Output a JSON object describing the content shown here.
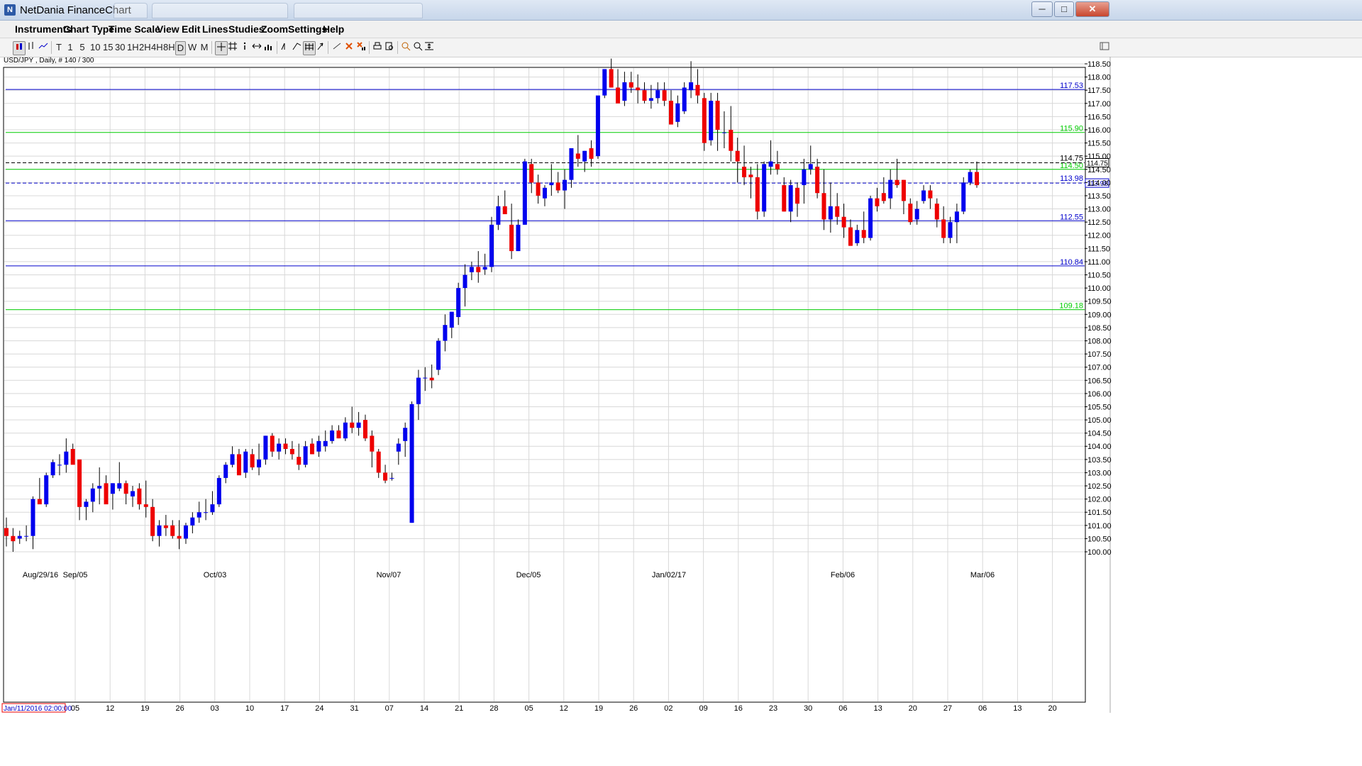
{
  "window": {
    "title": "NetDania FinanceChart",
    "controls": [
      "─",
      "□",
      "✕"
    ]
  },
  "menu": [
    "Instruments",
    "Chart Type",
    "Time Scale",
    "View",
    "Edit",
    "Lines",
    "Studies",
    "Zoom",
    "Settings",
    "Help"
  ],
  "toolbar": {
    "periods": [
      "T",
      "1",
      "5",
      "10",
      "15",
      "30",
      "1H",
      "2H",
      "4H",
      "8H",
      "D",
      "W",
      "M"
    ],
    "selected_period": "D"
  },
  "chart_info": "USD/JPY , Daily, # 140 / 300",
  "start_date_label": "Jan/11/2016 02:00:00",
  "chart_data": {
    "type": "candlestick",
    "instrument": "USD/JPY",
    "interval": "Daily",
    "ylim": [
      99.75,
      119.0
    ],
    "y_ticks": [
      100.0,
      100.5,
      101.0,
      101.5,
      102.0,
      102.5,
      103.0,
      103.5,
      104.0,
      104.5,
      105.0,
      105.5,
      106.0,
      106.5,
      107.0,
      107.5,
      108.0,
      108.5,
      109.0,
      109.5,
      110.0,
      110.5,
      111.0,
      111.5,
      112.0,
      112.5,
      113.0,
      113.5,
      114.0,
      114.5,
      115.0,
      115.5,
      116.0,
      116.5,
      117.0,
      117.5,
      118.0,
      118.5
    ],
    "x_ticks": [
      "05",
      "12",
      "19",
      "26",
      "03",
      "10",
      "17",
      "24",
      "31",
      "07",
      "14",
      "21",
      "28",
      "05",
      "12",
      "19",
      "26",
      "02",
      "09",
      "16",
      "23",
      "30",
      "06",
      "13",
      "20",
      "27",
      "06",
      "13",
      "20"
    ],
    "x_month_labels": [
      {
        "label": "Aug/29/16",
        "at": "Aug/29"
      },
      {
        "label": "Sep/05",
        "at": "05"
      },
      {
        "label": "Oct/03",
        "at": "03"
      },
      {
        "label": "Nov/07",
        "at": "07"
      },
      {
        "label": "Dec/05",
        "at": "05"
      },
      {
        "label": "Jan/02/17",
        "at": "02"
      },
      {
        "label": "Feb/06",
        "at": "06"
      },
      {
        "label": "Mar/06",
        "at": "06"
      }
    ],
    "horizontal_lines": [
      {
        "value": 117.53,
        "label": "117.53",
        "color": "#0000cc",
        "style": "solid"
      },
      {
        "value": 115.9,
        "label": "115.90",
        "color": "#00cc00",
        "style": "solid"
      },
      {
        "value": 114.5,
        "label": "114.50",
        "color": "#00cc00",
        "style": "solid"
      },
      {
        "value": 112.55,
        "label": "112.55",
        "color": "#0000cc",
        "style": "solid"
      },
      {
        "value": 110.84,
        "label": "110.84",
        "color": "#0000cc",
        "style": "solid"
      },
      {
        "value": 109.18,
        "label": "109.18",
        "color": "#00cc00",
        "style": "solid"
      },
      {
        "value": 114.75,
        "label": "114.75",
        "color": "#000000",
        "style": "dashed",
        "tag": "114.75"
      },
      {
        "value": 113.98,
        "label": "113.98",
        "color": "#0000cc",
        "style": "dashed",
        "tag": "113.98"
      }
    ],
    "colors": {
      "up": "#0000ee",
      "down": "#ee0000",
      "grid": "#d8d8d8"
    },
    "grid": true,
    "candles": [
      [
        100.9,
        101.3,
        100.2,
        100.6
      ],
      [
        100.6,
        100.9,
        100.0,
        100.4
      ],
      [
        100.5,
        100.8,
        100.3,
        100.6
      ],
      [
        100.6,
        101.0,
        100.4,
        100.6
      ],
      [
        100.6,
        102.1,
        100.1,
        102.0
      ],
      [
        102.0,
        102.8,
        101.9,
        101.8
      ],
      [
        101.8,
        103.0,
        101.7,
        102.9
      ],
      [
        102.9,
        103.5,
        102.8,
        103.4
      ],
      [
        103.3,
        103.7,
        102.9,
        103.3
      ],
      [
        103.3,
        104.3,
        103.0,
        103.8
      ],
      [
        103.9,
        104.1,
        103.6,
        103.3
      ],
      [
        103.5,
        103.5,
        101.2,
        101.7
      ],
      [
        101.7,
        102.0,
        101.2,
        101.9
      ],
      [
        101.9,
        102.6,
        101.5,
        102.4
      ],
      [
        102.4,
        103.2,
        101.8,
        102.5
      ],
      [
        102.6,
        102.9,
        101.9,
        101.8
      ],
      [
        102.2,
        102.6,
        101.6,
        102.6
      ],
      [
        102.4,
        103.4,
        102.3,
        102.6
      ],
      [
        102.6,
        102.7,
        101.8,
        102.2
      ],
      [
        102.1,
        102.5,
        101.7,
        102.3
      ],
      [
        102.4,
        102.6,
        101.6,
        101.8
      ],
      [
        101.8,
        102.7,
        101.3,
        101.7
      ],
      [
        101.7,
        102.0,
        100.4,
        100.6
      ],
      [
        100.6,
        101.2,
        100.2,
        101.0
      ],
      [
        101.0,
        101.4,
        100.6,
        100.9
      ],
      [
        101.0,
        101.2,
        100.5,
        100.6
      ],
      [
        100.6,
        101.2,
        100.1,
        100.5
      ],
      [
        100.5,
        101.1,
        100.3,
        101.0
      ],
      [
        101.0,
        101.5,
        100.7,
        101.3
      ],
      [
        101.3,
        101.9,
        101.1,
        101.5
      ],
      [
        101.5,
        102.0,
        101.2,
        101.5
      ],
      [
        101.5,
        102.3,
        101.4,
        101.8
      ],
      [
        101.8,
        102.9,
        101.7,
        102.8
      ],
      [
        102.8,
        103.4,
        102.6,
        103.3
      ],
      [
        103.3,
        104.0,
        103.2,
        103.7
      ],
      [
        103.7,
        103.9,
        103.1,
        102.9
      ],
      [
        103.0,
        103.9,
        102.8,
        103.8
      ],
      [
        103.7,
        103.9,
        103.1,
        103.2
      ],
      [
        103.2,
        104.1,
        102.9,
        103.5
      ],
      [
        103.5,
        104.4,
        103.3,
        104.4
      ],
      [
        104.4,
        104.5,
        103.6,
        103.8
      ],
      [
        103.8,
        104.3,
        103.5,
        104.1
      ],
      [
        104.1,
        104.3,
        103.7,
        103.9
      ],
      [
        103.9,
        104.2,
        103.5,
        103.7
      ],
      [
        103.6,
        104.1,
        103.1,
        103.3
      ],
      [
        103.3,
        104.2,
        103.2,
        104.0
      ],
      [
        104.1,
        104.3,
        103.7,
        103.7
      ],
      [
        103.8,
        104.4,
        103.6,
        104.2
      ],
      [
        104.0,
        104.6,
        103.8,
        104.2
      ],
      [
        104.2,
        104.8,
        104.1,
        104.6
      ],
      [
        104.6,
        104.8,
        104.3,
        104.3
      ],
      [
        104.3,
        105.1,
        104.2,
        104.9
      ],
      [
        104.9,
        105.5,
        104.5,
        104.7
      ],
      [
        104.7,
        105.3,
        104.4,
        104.9
      ],
      [
        105.0,
        105.2,
        104.2,
        104.3
      ],
      [
        104.4,
        104.6,
        103.2,
        103.8
      ],
      [
        103.8,
        103.9,
        102.8,
        103.0
      ],
      [
        103.0,
        103.3,
        102.6,
        102.7
      ],
      [
        102.8,
        103.0,
        102.7,
        102.8
      ],
      [
        103.8,
        104.3,
        103.3,
        104.1
      ],
      [
        104.2,
        104.9,
        103.6,
        104.7
      ],
      [
        101.1,
        105.7,
        101.1,
        105.6
      ],
      [
        105.6,
        106.9,
        105.0,
        106.6
      ],
      [
        106.6,
        107.0,
        106.1,
        106.6
      ],
      [
        106.6,
        107.1,
        106.2,
        106.5
      ],
      [
        106.9,
        108.1,
        106.7,
        108.0
      ],
      [
        108.0,
        109.0,
        107.6,
        108.6
      ],
      [
        108.5,
        109.1,
        108.1,
        109.1
      ],
      [
        108.9,
        110.2,
        108.6,
        110.0
      ],
      [
        110.0,
        110.9,
        109.3,
        110.5
      ],
      [
        110.6,
        111.0,
        110.3,
        110.8
      ],
      [
        110.8,
        111.4,
        110.2,
        110.6
      ],
      [
        110.7,
        111.3,
        110.5,
        110.8
      ],
      [
        110.8,
        112.7,
        110.6,
        112.4
      ],
      [
        112.4,
        113.5,
        112.2,
        113.1
      ],
      [
        113.1,
        113.7,
        112.8,
        112.8
      ],
      [
        112.4,
        113.2,
        111.1,
        111.4
      ],
      [
        111.4,
        112.6,
        111.4,
        112.4
      ],
      [
        112.4,
        114.9,
        112.4,
        114.8
      ],
      [
        114.7,
        114.9,
        113.6,
        114.0
      ],
      [
        114.0,
        114.3,
        113.2,
        113.5
      ],
      [
        113.4,
        113.9,
        113.1,
        113.8
      ],
      [
        113.9,
        114.7,
        113.5,
        114.0
      ],
      [
        114.0,
        114.4,
        113.6,
        113.7
      ],
      [
        113.7,
        114.5,
        113.0,
        114.1
      ],
      [
        114.1,
        115.0,
        113.8,
        115.3
      ],
      [
        115.1,
        115.8,
        114.6,
        114.9
      ],
      [
        114.8,
        115.2,
        114.4,
        115.2
      ],
      [
        115.3,
        115.6,
        114.6,
        114.9
      ],
      [
        115.0,
        117.2,
        114.9,
        117.3
      ],
      [
        117.3,
        118.3,
        117.2,
        118.3
      ],
      [
        118.3,
        118.7,
        117.6,
        117.6
      ],
      [
        117.6,
        118.3,
        117.1,
        117.0
      ],
      [
        117.1,
        118.2,
        116.9,
        117.8
      ],
      [
        117.8,
        118.2,
        117.4,
        117.6
      ],
      [
        117.6,
        118.1,
        117.0,
        117.5
      ],
      [
        117.5,
        117.8,
        117.0,
        117.1
      ],
      [
        117.1,
        117.7,
        116.8,
        117.2
      ],
      [
        117.2,
        117.8,
        117.0,
        117.5
      ],
      [
        117.5,
        117.8,
        116.9,
        117.1
      ],
      [
        117.1,
        117.5,
        116.2,
        116.2
      ],
      [
        116.3,
        117.3,
        116.1,
        117.0
      ],
      [
        116.7,
        117.8,
        116.6,
        117.6
      ],
      [
        117.5,
        118.6,
        117.2,
        117.8
      ],
      [
        117.7,
        118.3,
        117.0,
        117.3
      ],
      [
        117.2,
        117.4,
        115.2,
        115.5
      ],
      [
        115.6,
        117.4,
        115.4,
        117.1
      ],
      [
        117.1,
        117.4,
        115.2,
        116.0
      ],
      [
        115.9,
        116.7,
        115.3,
        115.9
      ],
      [
        116.0,
        116.9,
        114.8,
        115.2
      ],
      [
        115.2,
        115.7,
        114.0,
        114.8
      ],
      [
        114.6,
        115.4,
        113.9,
        114.2
      ],
      [
        114.3,
        114.6,
        113.4,
        114.2
      ],
      [
        114.2,
        114.7,
        112.6,
        112.9
      ],
      [
        112.9,
        114.8,
        112.7,
        114.7
      ],
      [
        114.6,
        115.6,
        114.3,
        114.8
      ],
      [
        114.7,
        115.2,
        114.3,
        114.5
      ],
      [
        113.9,
        114.2,
        112.9,
        112.9
      ],
      [
        112.9,
        114.1,
        112.5,
        113.9
      ],
      [
        113.8,
        114.0,
        112.7,
        113.2
      ],
      [
        113.9,
        114.9,
        113.2,
        114.5
      ],
      [
        114.5,
        115.4,
        114.3,
        114.7
      ],
      [
        114.6,
        114.9,
        113.4,
        113.6
      ],
      [
        113.6,
        114.5,
        112.2,
        112.6
      ],
      [
        112.6,
        114.0,
        112.1,
        113.1
      ],
      [
        113.1,
        113.6,
        112.4,
        112.7
      ],
      [
        112.7,
        113.2,
        111.9,
        112.3
      ],
      [
        112.3,
        112.6,
        111.6,
        111.6
      ],
      [
        111.7,
        112.4,
        111.6,
        112.2
      ],
      [
        112.2,
        112.9,
        111.7,
        111.9
      ],
      [
        111.9,
        113.5,
        111.8,
        113.4
      ],
      [
        113.4,
        113.8,
        112.9,
        113.1
      ],
      [
        113.6,
        114.2,
        113.2,
        113.3
      ],
      [
        113.4,
        114.5,
        113.0,
        114.1
      ],
      [
        114.1,
        114.9,
        113.8,
        113.9
      ],
      [
        114.1,
        114.1,
        112.8,
        113.3
      ],
      [
        113.2,
        113.4,
        112.4,
        112.5
      ],
      [
        112.6,
        113.3,
        112.4,
        113.0
      ],
      [
        113.3,
        113.9,
        113.2,
        113.7
      ],
      [
        113.7,
        113.9,
        113.0,
        113.4
      ],
      [
        113.2,
        113.4,
        112.3,
        112.6
      ],
      [
        112.6,
        113.1,
        111.7,
        111.9
      ],
      [
        111.9,
        112.7,
        111.7,
        112.5
      ],
      [
        112.5,
        113.2,
        111.7,
        112.9
      ],
      [
        112.9,
        114.2,
        112.8,
        114.0
      ],
      [
        114.0,
        114.5,
        113.9,
        114.4
      ],
      [
        114.4,
        114.8,
        113.8,
        113.9
      ]
    ]
  }
}
